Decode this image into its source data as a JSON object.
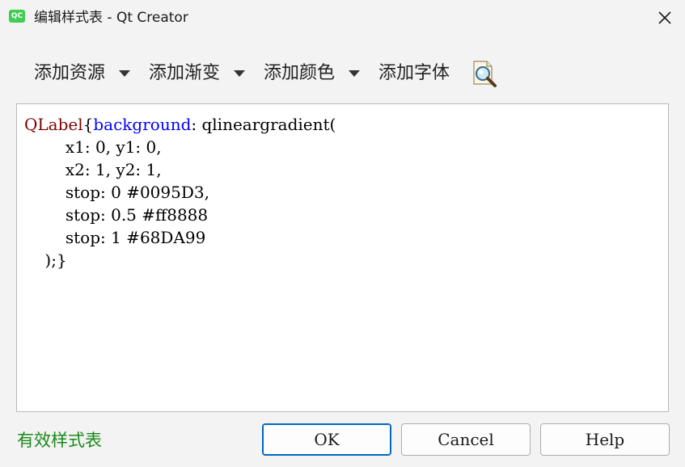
{
  "window": {
    "app_icon_text": "QC",
    "title": "编辑样式表 - Qt Creator"
  },
  "toolbar": {
    "add_resource": "添加资源",
    "add_gradient": "添加渐变",
    "add_color": "添加颜色",
    "add_font": "添加字体"
  },
  "editor": {
    "lines": [
      [
        {
          "t": "sel",
          "v": "QLabel"
        },
        {
          "t": "plain",
          "v": "{"
        },
        {
          "t": "prop",
          "v": "background"
        },
        {
          "t": "plain",
          "v": ": qlineargradient("
        }
      ],
      [
        {
          "t": "plain",
          "v": "        x1: 0, y1: 0,"
        }
      ],
      [
        {
          "t": "plain",
          "v": "        x2: 1, y2: 1,"
        }
      ],
      [
        {
          "t": "plain",
          "v": "        stop: 0 #0095D3,"
        }
      ],
      [
        {
          "t": "plain",
          "v": "        stop: 0.5 #ff8888"
        }
      ],
      [
        {
          "t": "plain",
          "v": "        stop: 1 #68DA99"
        }
      ],
      [
        {
          "t": "plain",
          "v": "    );}"
        }
      ]
    ]
  },
  "footer": {
    "status": "有效样式表",
    "ok": "OK",
    "cancel": "Cancel",
    "help": "Help"
  },
  "colors": {
    "selector": "#800000",
    "property": "#0000ff",
    "status_valid": "#1a8a1a",
    "default_button_border": "#0067c0"
  },
  "icons": {
    "close": "close-icon",
    "dropdown": "triangle-down-icon",
    "find": "magnifier-page-icon"
  }
}
